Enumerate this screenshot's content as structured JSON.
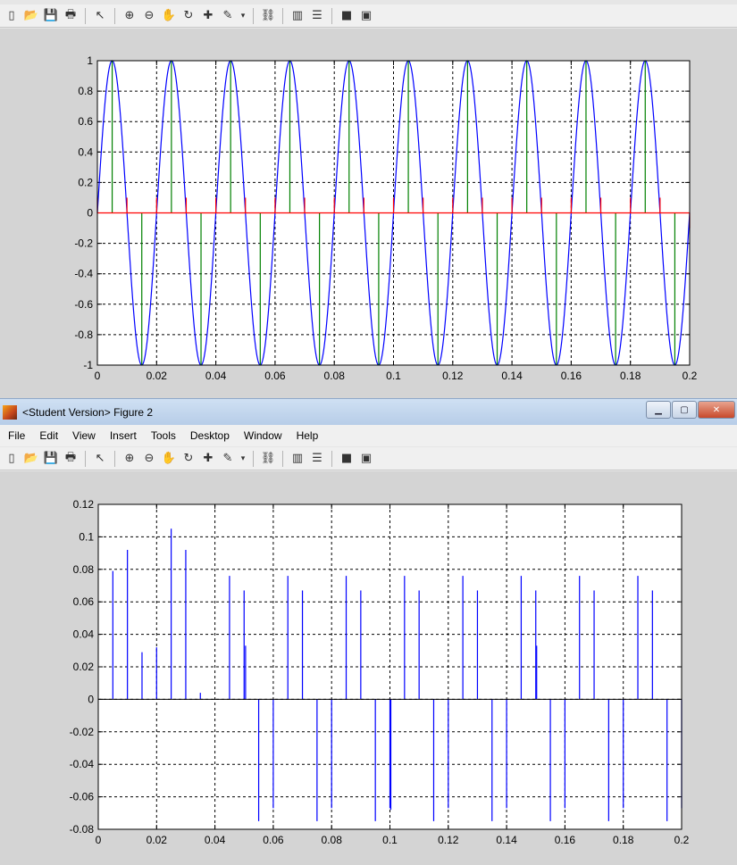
{
  "window2": {
    "title": "<Student Version> Figure 2",
    "menu": [
      "File",
      "Edit",
      "View",
      "Insert",
      "Tools",
      "Desktop",
      "Window",
      "Help"
    ]
  },
  "toolbar_icons": [
    "new-figure-icon",
    "open-file-icon",
    "save-icon",
    "print-icon",
    "|",
    "edit-plot-arrow-icon",
    "|",
    "zoom-in-icon",
    "zoom-out-icon",
    "pan-hand-icon",
    "rotate-3d-icon",
    "data-cursor-icon",
    "brush-icon",
    "brush-dropdown-icon",
    "|",
    "link-plot-icon",
    "|",
    "insert-colorbar-icon",
    "insert-legend-icon",
    "|",
    "hide-plot-tools-icon",
    "show-plot-tools-icon"
  ],
  "chart_data": [
    {
      "type": "line",
      "description": "sine wave sampled: continuous curve, stem samples, and step trace",
      "x_ticks": [
        "0",
        "0.02",
        "0.04",
        "0.06",
        "0.08",
        "0.1",
        "0.12",
        "0.14",
        "0.16",
        "0.18",
        "0.2"
      ],
      "y_ticks": [
        "1",
        "0.8",
        "0.6",
        "0.4",
        "0.2",
        "0",
        "-0.2",
        "-0.4",
        "-0.6",
        "-0.8",
        "-1"
      ],
      "xlim": [
        0,
        0.2
      ],
      "ylim": [
        -1,
        1
      ],
      "grid": true,
      "series": [
        {
          "kind": "curve",
          "color": "#0000ff",
          "frequency": 50,
          "amplitude": 1
        },
        {
          "kind": "stem",
          "color": "#008000",
          "x": [
            0.005,
            0.015,
            0.025,
            0.035,
            0.045,
            0.055,
            0.065,
            0.075,
            0.085,
            0.095,
            0.105,
            0.115,
            0.125,
            0.135,
            0.145,
            0.155,
            0.165,
            0.175,
            0.185,
            0.195
          ],
          "y": [
            1,
            -1,
            1,
            -1,
            1,
            -1,
            1,
            -1,
            1,
            -1,
            1,
            -1,
            1,
            -1,
            1,
            -1,
            1,
            -1,
            1,
            -1
          ]
        },
        {
          "kind": "stem",
          "color": "#ff0000",
          "x": [
            0,
            0.01,
            0.02,
            0.03,
            0.04,
            0.05,
            0.06,
            0.07,
            0.08,
            0.09,
            0.1,
            0.11,
            0.12,
            0.13,
            0.14,
            0.15,
            0.16,
            0.17,
            0.18,
            0.19,
            0.2
          ],
          "y": [
            0.1,
            0.1,
            0.1,
            0.1,
            0.1,
            0.1,
            0.1,
            0.1,
            0.1,
            0.1,
            0.1,
            0.1,
            0.1,
            0.1,
            0.1,
            0.1,
            0.1,
            0.1,
            0.1,
            0.1,
            -0.1
          ]
        }
      ]
    },
    {
      "type": "bar",
      "description": "stem plot of residual values",
      "x_ticks": [
        "0",
        "0.02",
        "0.04",
        "0.06",
        "0.08",
        "0.1",
        "0.12",
        "0.14",
        "0.16",
        "0.18",
        "0.2"
      ],
      "y_ticks": [
        "0.12",
        "0.1",
        "0.08",
        "0.06",
        "0.04",
        "0.02",
        "0",
        "-0.02",
        "-0.04",
        "-0.06",
        "-0.08"
      ],
      "xlim": [
        0,
        0.2
      ],
      "ylim": [
        -0.08,
        0.12
      ],
      "grid": true,
      "series": [
        {
          "kind": "stem",
          "color": "#0000ff",
          "x": [
            0.005,
            0.01,
            0.015,
            0.02,
            0.025,
            0.03,
            0.035,
            0.045,
            0.05,
            0.0505,
            0.055,
            0.06,
            0.065,
            0.07,
            0.075,
            0.08,
            0.085,
            0.09,
            0.095,
            0.1,
            0.1003,
            0.105,
            0.11,
            0.115,
            0.12,
            0.125,
            0.13,
            0.135,
            0.14,
            0.145,
            0.15,
            0.1503,
            0.155,
            0.16,
            0.165,
            0.17,
            0.175,
            0.18,
            0.185,
            0.19,
            0.195,
            0.2
          ],
          "y": [
            0.079,
            0.092,
            0.029,
            0.032,
            0.105,
            0.092,
            0.004,
            0.076,
            0.067,
            0.033,
            -0.075,
            -0.067,
            0.076,
            0.067,
            -0.075,
            -0.067,
            0.076,
            0.067,
            -0.075,
            -0.067,
            -0.068,
            0.076,
            0.067,
            -0.075,
            -0.067,
            0.076,
            0.067,
            -0.075,
            -0.067,
            0.076,
            0.067,
            0.033,
            -0.075,
            -0.067,
            0.076,
            0.067,
            -0.075,
            -0.067,
            0.076,
            0.067,
            -0.075,
            -0.067
          ]
        }
      ]
    }
  ]
}
